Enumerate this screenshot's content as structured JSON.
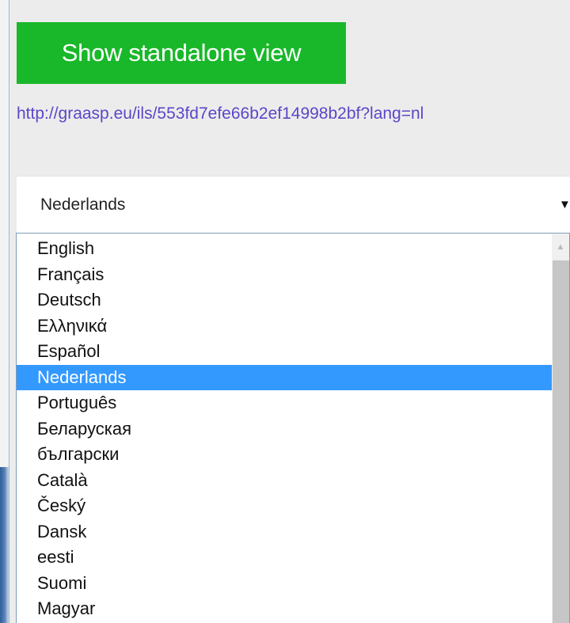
{
  "standalone": {
    "button_label": "Show standalone view"
  },
  "url": {
    "text": "http://graasp.eu/ils/553fd7efe66b2ef14998b2bf?lang=nl"
  },
  "language_select": {
    "selected": "Nederlands",
    "caret": "▼",
    "options": [
      "English",
      "Français",
      "Deutsch",
      "Ελληνικά",
      "Español",
      "Nederlands",
      "Português",
      "Беларуская",
      "български",
      "Català",
      "Český",
      "Dansk",
      "eesti",
      "Suomi",
      "Magyar"
    ],
    "selected_index": 5
  },
  "scrollbar": {
    "up_arrow": "▲"
  },
  "colors": {
    "button_green": "#19b82a",
    "link_purple": "#5b46c8",
    "selection_blue": "#3399ff"
  }
}
